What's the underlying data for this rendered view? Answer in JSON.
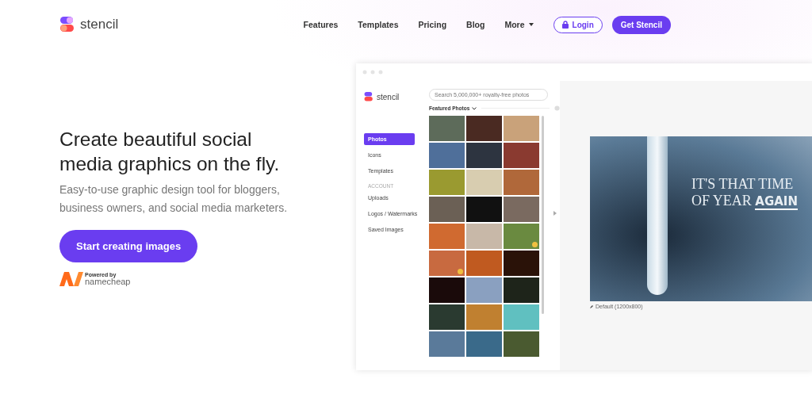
{
  "header": {
    "brand": "stencil",
    "nav": [
      {
        "label": "Features",
        "kind": "link"
      },
      {
        "label": "Templates",
        "kind": "link"
      },
      {
        "label": "Pricing",
        "kind": "link"
      },
      {
        "label": "Blog",
        "kind": "link"
      },
      {
        "label": "More",
        "kind": "dropdown"
      },
      {
        "label": "Login",
        "kind": "outline"
      },
      {
        "label": "Get Stencil",
        "kind": "solid"
      }
    ]
  },
  "hero": {
    "title": "Create beautiful social media graphics on the fly.",
    "subtitle": "Easy-to-use graphic design tool for bloggers, business owners, and social media marketers.",
    "cta": "Start creating images",
    "powered_by": "Powered by",
    "partner": "namecheap"
  },
  "app": {
    "brand": "stencil",
    "search": {
      "placeholder": "Search 5,000,000+ royalty-free photos"
    },
    "section_title": "Featured Photos",
    "sidebar": [
      {
        "label": "Photos",
        "kind": "item",
        "selected": true
      },
      {
        "label": "Icons",
        "kind": "item",
        "selected": false
      },
      {
        "label": "Templates",
        "kind": "item",
        "selected": false
      },
      {
        "label": "ACCOUNT",
        "kind": "heading"
      },
      {
        "label": "Uploads",
        "kind": "item",
        "selected": false
      },
      {
        "label": "Logos / Watermarks",
        "kind": "item",
        "selected": false
      },
      {
        "label": "Saved Images",
        "kind": "item",
        "selected": false
      }
    ],
    "photos": [
      {
        "premium": false
      },
      {
        "premium": false
      },
      {
        "premium": false
      },
      {
        "premium": false
      },
      {
        "premium": false
      },
      {
        "premium": false
      },
      {
        "premium": false
      },
      {
        "premium": false
      },
      {
        "premium": false
      },
      {
        "premium": false
      },
      {
        "premium": false
      },
      {
        "premium": false
      },
      {
        "premium": false
      },
      {
        "premium": false
      },
      {
        "premium": true
      },
      {
        "premium": true
      },
      {
        "premium": false
      },
      {
        "premium": false
      },
      {
        "premium": false
      },
      {
        "premium": false
      },
      {
        "premium": false
      },
      {
        "premium": false
      },
      {
        "premium": false
      },
      {
        "premium": false
      },
      {
        "premium": false
      },
      {
        "premium": false
      },
      {
        "premium": false
      }
    ],
    "canvas": {
      "line_1": "IT'S THAT TIME",
      "line_2_prefix": "OF YEAR",
      "line_2_emphasis": "AGAIN",
      "size_label": "Default (1200x800)"
    }
  }
}
